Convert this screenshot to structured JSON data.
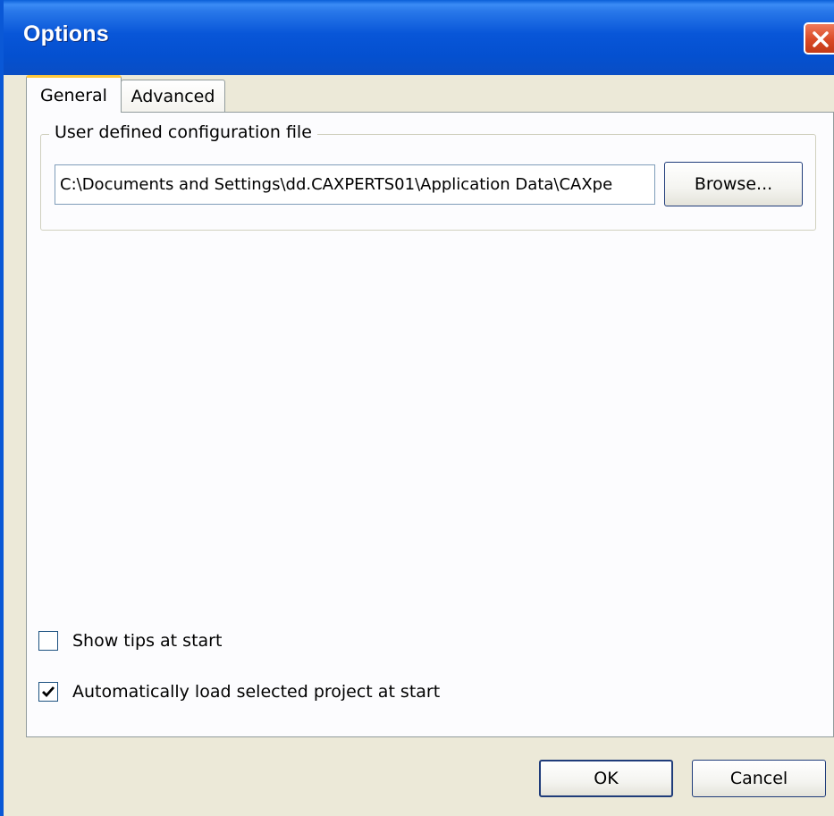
{
  "window": {
    "title": "Options"
  },
  "tabs": [
    {
      "label": "General",
      "selected": true
    },
    {
      "label": "Advanced",
      "selected": false
    }
  ],
  "config_group": {
    "legend": "User defined configuration file",
    "path_value": "C:\\Documents and Settings\\dd.CAXPERTS01\\Application Data\\CAXpe",
    "browse_label": "Browse..."
  },
  "checkboxes": [
    {
      "label": "Show tips at start",
      "checked": false
    },
    {
      "label": "Automatically load selected project at start",
      "checked": true
    }
  ],
  "footer": {
    "ok_label": "OK",
    "cancel_label": "Cancel"
  },
  "icons": {
    "close": "close-icon",
    "check": "checkmark-icon"
  },
  "colors": {
    "titlebar": "#0856d8",
    "dialog_bg": "#ece9d8",
    "close_button": "#d94a26",
    "tab_highlight": "#ffc83c"
  }
}
